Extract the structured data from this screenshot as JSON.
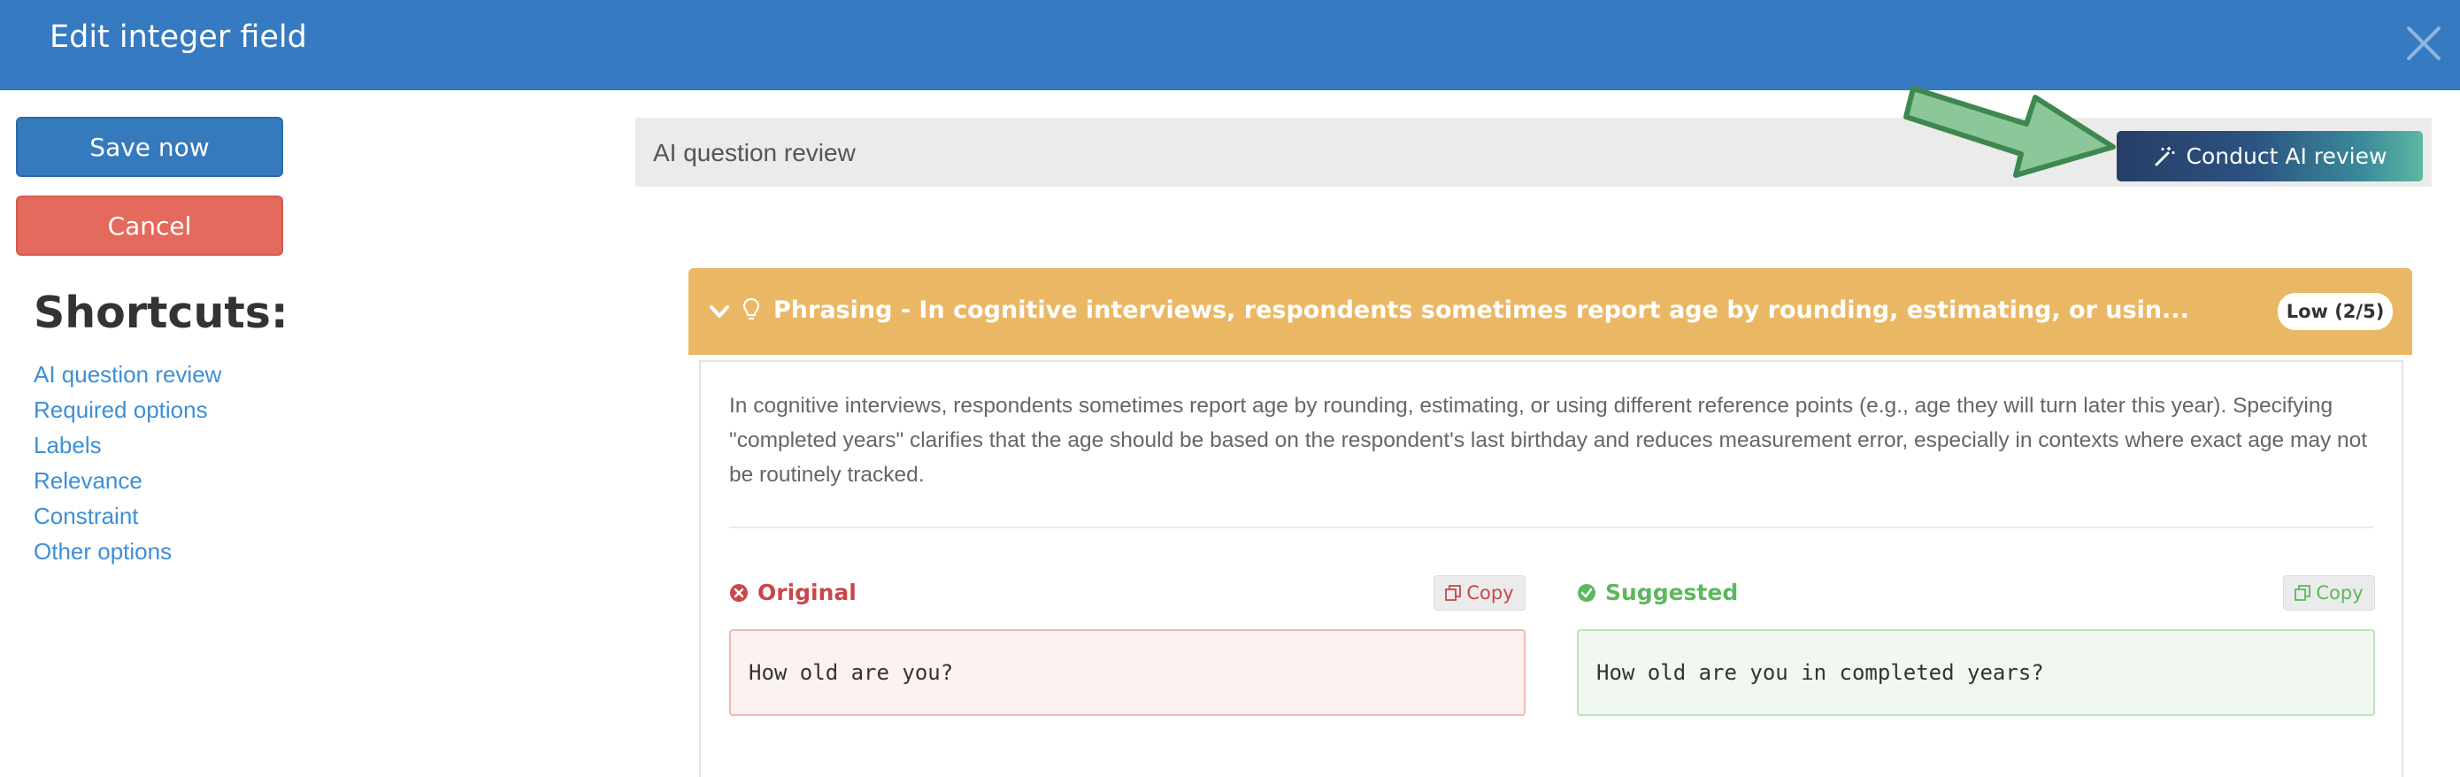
{
  "header": {
    "title": "Edit integer field"
  },
  "sidebar": {
    "save_label": "Save now",
    "cancel_label": "Cancel",
    "shortcuts_title": "Shortcuts:",
    "shortcuts": [
      "AI question review",
      "Required options",
      "Labels",
      "Relevance",
      "Constraint",
      "Other options"
    ]
  },
  "ai_review": {
    "section_label": "AI question review",
    "button_label": "Conduct AI review"
  },
  "finding": {
    "title": "Phrasing - In cognitive interviews, respondents sometimes report age by rounding, estimating, or usin...",
    "severity": "Low (2/5)",
    "description": "In cognitive interviews, respondents sometimes report age by rounding, estimating, or using different reference points (e.g., age they will turn later this year). Specifying \"completed years\" clarifies that the age should be based on the respondent's last birthday and reduces measurement error, especially in contexts where exact age may not be routinely tracked.",
    "original_label": "Original",
    "suggested_label": "Suggested",
    "copy_label": "Copy",
    "original_text": "How old are you?",
    "suggested_text": "How old are you in completed years?"
  },
  "colors": {
    "header": "#367bc1",
    "save": "#357abd",
    "cancel": "#e36a5c",
    "finding_header": "#eab865",
    "original": "#c9474a",
    "suggested": "#5cb85c",
    "arrow": "#8cc79a"
  },
  "icons": {
    "close": "close-icon",
    "magic": "magic-wand-icon",
    "chevron": "chevron-down-icon",
    "bulb": "lightbulb-icon",
    "error": "x-circle-icon",
    "check": "check-circle-icon",
    "copy": "copy-icon"
  }
}
